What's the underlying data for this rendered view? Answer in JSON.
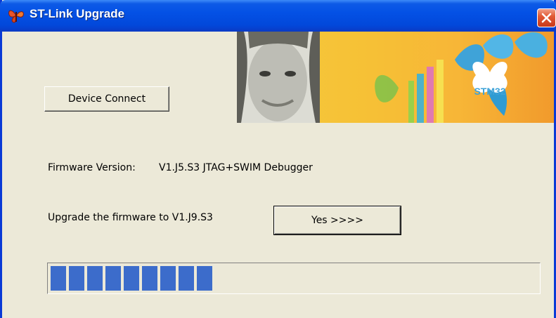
{
  "window": {
    "title": "ST-Link Upgrade"
  },
  "banner": {
    "logo_text": "STM32"
  },
  "buttons": {
    "device_connect": "Device Connect",
    "yes": "Yes >>>>"
  },
  "firmware": {
    "version_label": "Firmware Version:",
    "version_value": "V1.J5.S3 JTAG+SWIM Debugger",
    "upgrade_prompt": "Upgrade the firmware to V1.J9.S3"
  },
  "progress": {
    "fraction": 0.33,
    "segments": 9
  },
  "colors": {
    "title_bar": "#0451e5",
    "window_bg": "#ece9d8",
    "progress_fill": "#3c6ccb",
    "close_button": "#e25a36"
  },
  "icons": {
    "app": "butterfly-icon",
    "close": "close-icon"
  }
}
